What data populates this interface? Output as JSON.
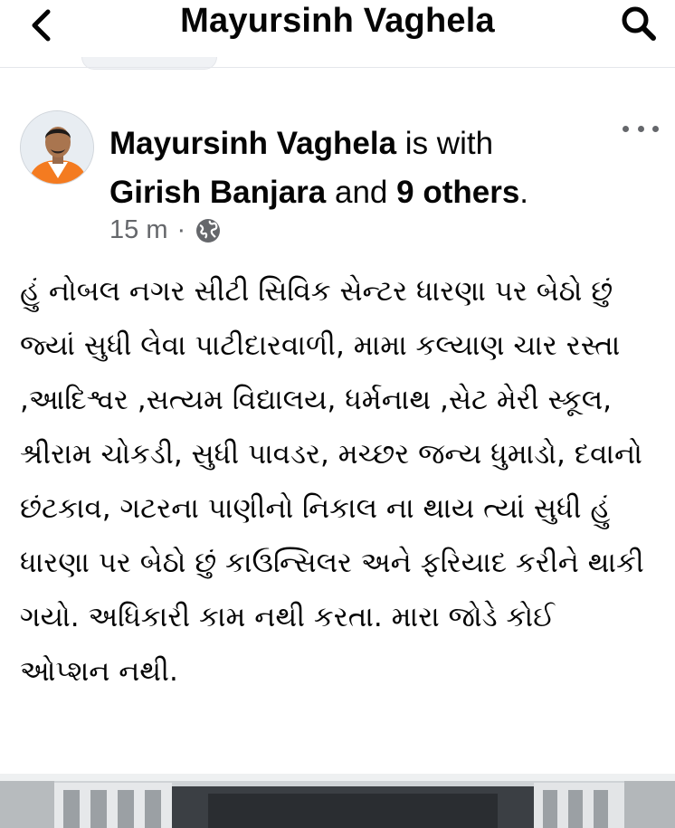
{
  "header": {
    "title": "Mayursinh Vaghela",
    "back_icon": "chevron-left-icon",
    "search_icon": "search-icon"
  },
  "post": {
    "author": "Mayursinh Vaghela",
    "with_text": " is with",
    "tagged_name": "Girish Banjara",
    "and_text": " and ",
    "others": "9 others",
    "period": ".",
    "time": "15 m",
    "dot": "·",
    "privacy_icon": "globe-icon",
    "more_icon": "more-horizontal-icon",
    "text": "હું નોબલ નગર સીટી સિવિક સેન્ટર ધારણા પર બેઠો છું જ્યાં સુધી લેવા પાટીદારવાળી, મામા કલ્યાણ ચાર રસ્તા ,આદિશ્વર ,સત્યમ વિદ્યાલય, ધર્મનાથ ,સેટ મેરી સ્કૂલ, શ્રીરામ ચોકડી, સુધી પાવડર, મચ્છર જન્ય ધુમાડો, દવાનો છંટકાવ, ગટરના પાણીનો નિકાલ ના થાય ત્યાં સુધી હું ધારણા પર બેઠો છું કાઉન્સિલર અને ફરિયાદ કરીને થાકી ગયો. અધિકારી કામ નથી કરતા. મારા જોડે કોઈ ઓપ્શન નથી."
  },
  "colors": {
    "text": "#050505",
    "secondary": "#65676b",
    "divider": "#e4e6eb"
  }
}
